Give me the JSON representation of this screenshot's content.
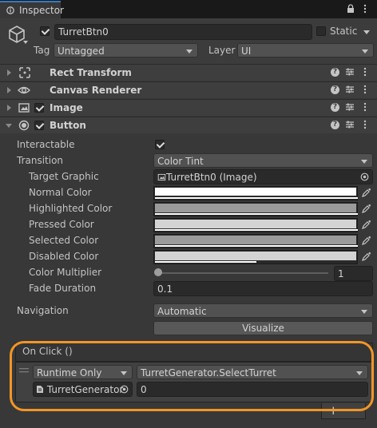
{
  "tab": {
    "label": "Inspector",
    "lock_icon": "lock-icon",
    "menu_icon": "kebab-menu-icon"
  },
  "header": {
    "object_name": "TurretBtn0",
    "active": true,
    "static_label": "Static",
    "tag_label": "Tag",
    "tag_value": "Untagged",
    "layer_label": "Layer",
    "layer_value": "UI"
  },
  "components": {
    "rect_transform": "Rect Transform",
    "canvas_renderer": "Canvas Renderer",
    "image": "Image",
    "button": "Button"
  },
  "button": {
    "interactable_label": "Interactable",
    "interactable": true,
    "transition_label": "Transition",
    "transition_value": "Color Tint",
    "target_graphic_label": "Target Graphic",
    "target_graphic_value": "TurretBtn0 (Image)",
    "normal_color_label": "Normal Color",
    "normal_color": "#ffffff",
    "highlighted_color_label": "Highlighted Color",
    "highlighted_color": "#f5f5f5",
    "pressed_color_label": "Pressed Color",
    "pressed_color": "#c8c8c8",
    "selected_color_label": "Selected Color",
    "selected_color": "#f5f5f5",
    "disabled_color_label": "Disabled Color",
    "disabled_color": "#c8c8c8",
    "disabled_alpha": 0.5,
    "color_multiplier_label": "Color Multiplier",
    "color_multiplier_value": "1",
    "fade_duration_label": "Fade Duration",
    "fade_duration_value": "0.1",
    "navigation_label": "Navigation",
    "navigation_value": "Automatic",
    "visualize_label": "Visualize"
  },
  "on_click": {
    "title": "On Click ()",
    "runtime_value": "Runtime Only",
    "function_value": "TurretGenerator.SelectTurret",
    "target_object": "TurretGenerator",
    "argument_value": "0",
    "add_label": "+",
    "remove_label": "−"
  },
  "colors": {
    "highlight_ring": "#f39527",
    "tab_accent": "#3a79bb"
  }
}
